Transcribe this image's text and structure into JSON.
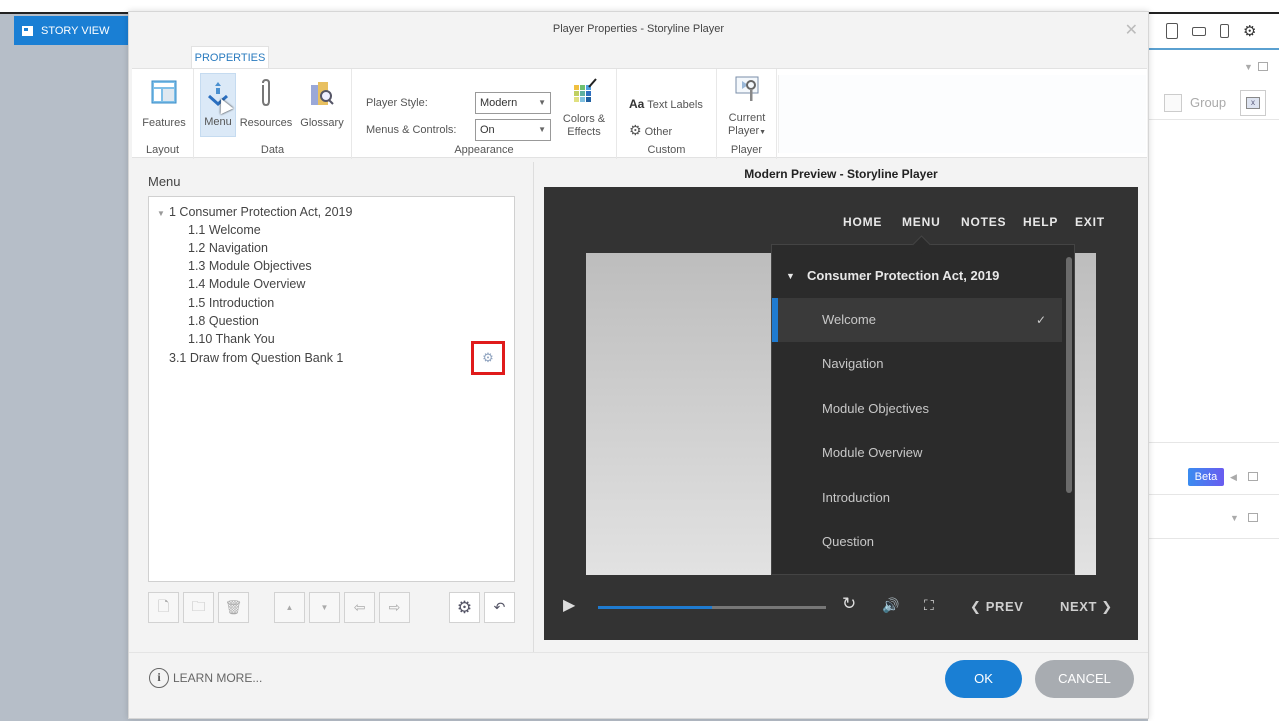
{
  "background": {
    "story_view_tab": "STORY VIEW",
    "right_panel": {
      "group_label": "Group",
      "beta_badge": "Beta"
    }
  },
  "dialog": {
    "title": "Player Properties - Storyline Player",
    "ribbon_tab": "PROPERTIES",
    "groups": {
      "layout": {
        "label": "Layout",
        "buttons": [
          {
            "label": "Features",
            "icon": "features-icon"
          }
        ]
      },
      "data": {
        "label": "Data",
        "buttons": [
          {
            "label": "Menu",
            "icon": "menu-icon",
            "active": true
          },
          {
            "label": "Resources",
            "icon": "paperclip-icon"
          },
          {
            "label": "Glossary",
            "icon": "glossary-icon"
          }
        ]
      },
      "appearance": {
        "label": "Appearance",
        "player_style_label": "Player Style:",
        "player_style_value": "Modern",
        "menus_controls_label": "Menus & Controls:",
        "menus_controls_value": "On",
        "colors_effects_line1": "Colors &",
        "colors_effects_line2": "Effects"
      },
      "custom": {
        "label": "Custom",
        "text_labels_prefix": "Aa",
        "text_labels": "Text Labels",
        "other": "Other"
      },
      "player": {
        "label": "Player",
        "current_line1": "Current",
        "current_line2": "Player"
      }
    },
    "menu_pane": {
      "heading": "Menu",
      "items": [
        {
          "label": "1 Consumer Protection Act, 2019",
          "level": 0
        },
        {
          "label": "1.1 Welcome",
          "level": 1
        },
        {
          "label": "1.2 Navigation",
          "level": 1
        },
        {
          "label": "1.3 Module Objectives",
          "level": 1
        },
        {
          "label": "1.4 Module Overview",
          "level": 1
        },
        {
          "label": "1.5 Introduction",
          "level": 1
        },
        {
          "label": "1.8 Question",
          "level": 1
        },
        {
          "label": "1.10 Thank You",
          "level": 1
        },
        {
          "label": "3.1 Draw from Question Bank 1",
          "level": 0
        }
      ]
    },
    "preview": {
      "title": "Modern Preview - Storyline Player",
      "nav": [
        "HOME",
        "MENU",
        "NOTES",
        "HELP",
        "EXIT"
      ],
      "menu_header": "Consumer Protection Act, 2019",
      "menu_items": [
        {
          "label": "Welcome",
          "selected": true
        },
        {
          "label": "Navigation"
        },
        {
          "label": "Module Objectives"
        },
        {
          "label": "Module Overview"
        },
        {
          "label": "Introduction"
        },
        {
          "label": "Question"
        }
      ],
      "seek_progress": 0.5,
      "prev_label": "PREV",
      "next_label": "NEXT",
      "accent_color": "#1f7bd0"
    },
    "footer": {
      "learn_more": "LEARN MORE...",
      "ok": "OK",
      "cancel": "CANCEL"
    }
  }
}
